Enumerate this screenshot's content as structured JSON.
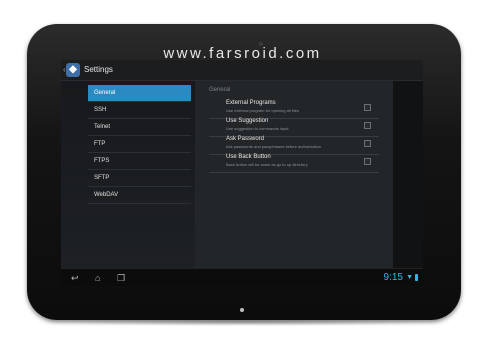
{
  "watermark": "www.farsroid.com",
  "app": {
    "title": "Settings",
    "icon": "app-icon"
  },
  "nav": {
    "items": [
      {
        "label": "General"
      },
      {
        "label": "SSH"
      },
      {
        "label": "Telnet"
      },
      {
        "label": "FTP"
      },
      {
        "label": "FTPS"
      },
      {
        "label": "SFTP"
      },
      {
        "label": "WebDAV"
      }
    ],
    "selected": "General"
  },
  "detail": {
    "section": "General",
    "prefs": [
      {
        "title": "External Programs",
        "subtitle": "Use external program for opening all files",
        "checked": false
      },
      {
        "title": "Use Suggestion",
        "subtitle": "Use suggestion to commands input",
        "checked": false
      },
      {
        "title": "Ask Password",
        "subtitle": "Ask passwords and passphrases before authorization",
        "checked": false
      },
      {
        "title": "Use Back Button",
        "subtitle": "Back button will be same as go to up directory",
        "checked": false
      }
    ]
  },
  "status": {
    "time": "9:15",
    "icons": [
      "back-icon",
      "home-icon",
      "recent-apps-icon",
      "wifi-icon",
      "battery-icon"
    ]
  },
  "colors": {
    "accent": "#2c8ac2",
    "clock": "#33b5e5",
    "bezel": "#141414"
  }
}
